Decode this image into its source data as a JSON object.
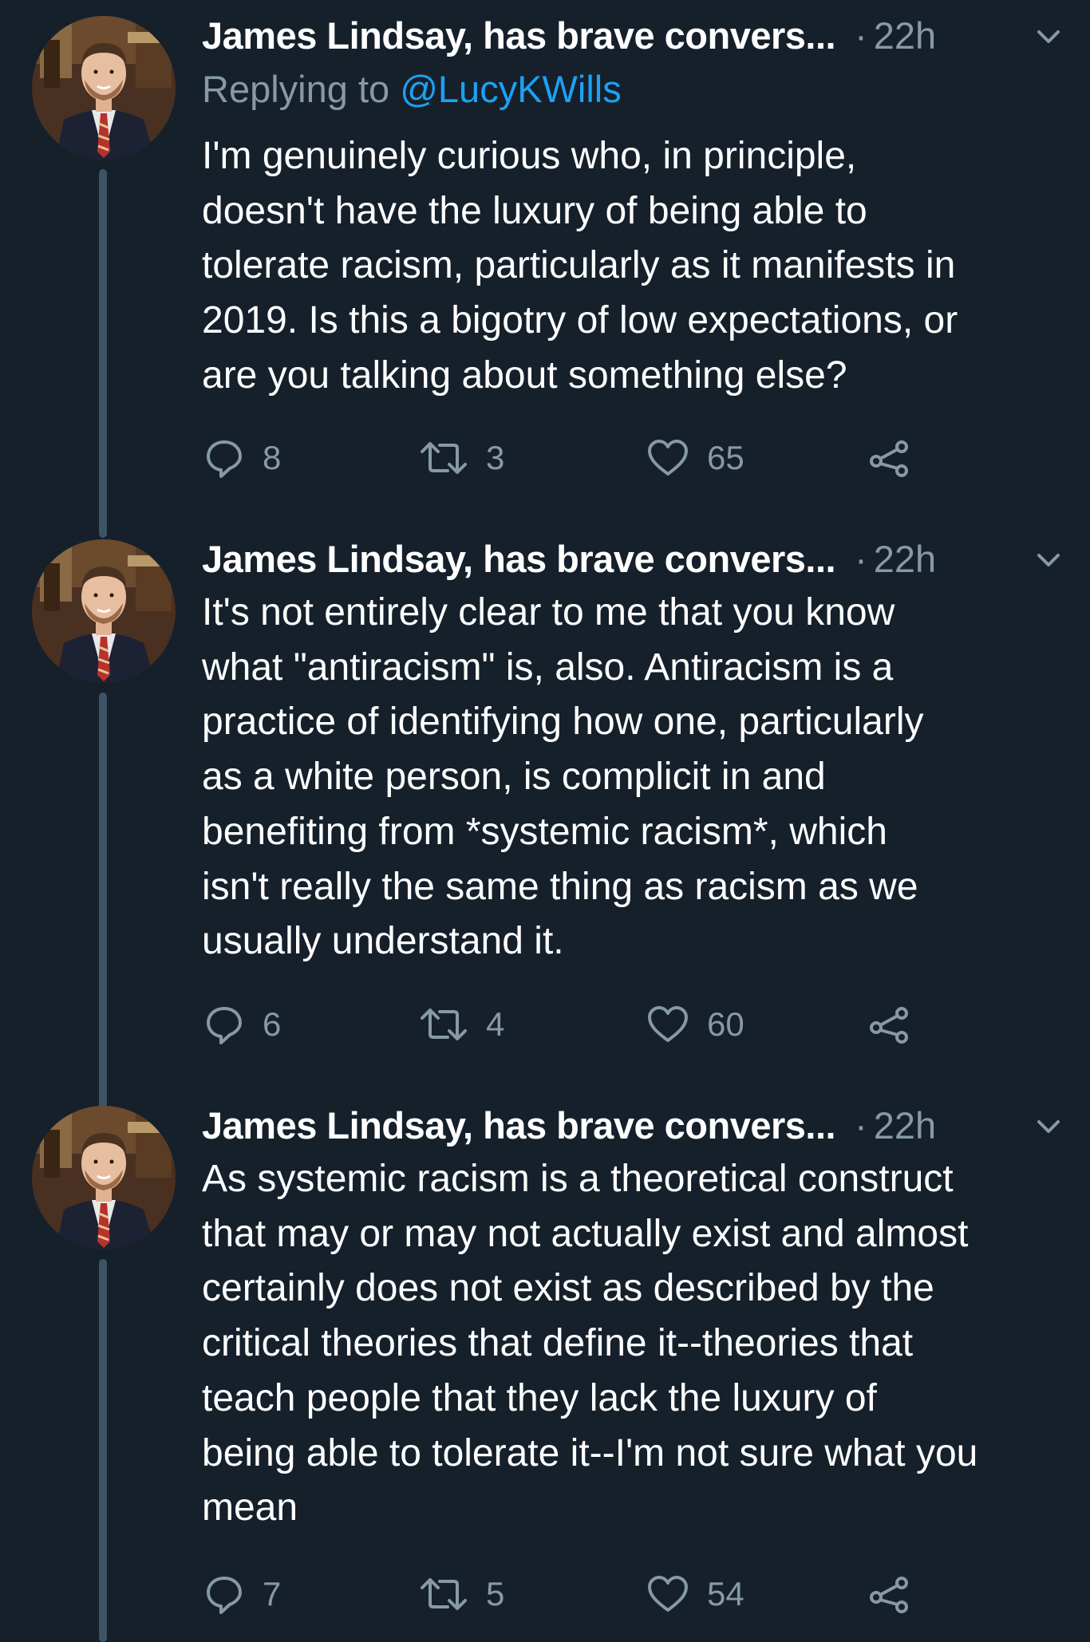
{
  "tweets": [
    {
      "author": "James Lindsay, has brave convers...",
      "separator": "·",
      "time": "22h",
      "replying_to_prefix": "Replying to ",
      "replying_to_handle": "@LucyKWills",
      "body_lines": [
        "I'm genuinely curious who, in principle,",
        "doesn't have the luxury of being able to",
        "tolerate racism, particularly as it manifests in",
        "2019. Is this a bigotry of low expectations, or",
        "are you talking about something else?"
      ],
      "replies": "8",
      "retweets": "3",
      "likes": "65"
    },
    {
      "author": "James Lindsay, has brave convers...",
      "separator": "·",
      "time": "22h",
      "body_lines": [
        "It's not entirely clear to me that you know",
        "what \"antiracism\" is, also. Antiracism is a",
        "practice of identifying how one, particularly",
        "as a white person, is complicit in and",
        "benefiting from *systemic racism*, which",
        "isn't really the same thing as racism as we",
        "usually understand it."
      ],
      "replies": "6",
      "retweets": "4",
      "likes": "60"
    },
    {
      "author": "James Lindsay, has brave convers...",
      "separator": "·",
      "time": "22h",
      "body_lines": [
        "As systemic racism is a theoretical construct",
        "that may or may not actually exist and almost",
        "certainly does not exist as described by the",
        "critical theories that define it--theories that",
        "teach people that they lack the luxury of",
        "being able to tolerate it--I'm not sure what you",
        "mean"
      ],
      "replies": "7",
      "retweets": "5",
      "likes": "54"
    }
  ],
  "icons": {
    "reply": "reply-icon",
    "retweet": "retweet-icon",
    "like": "heart-icon",
    "share": "share-icon",
    "menu": "chevron-down-icon"
  },
  "colors": {
    "background": "#15202b",
    "secondary_text": "#8899a6",
    "link": "#1da1f2",
    "thread_line": "#3d5466"
  }
}
